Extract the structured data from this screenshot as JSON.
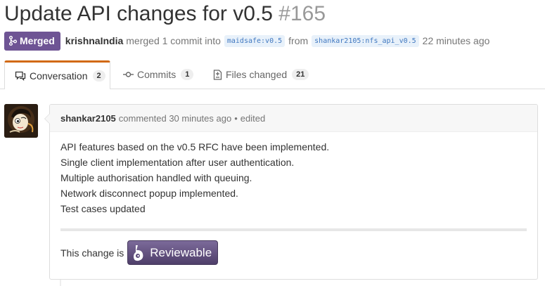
{
  "pr": {
    "title": "Update API changes for v0.5",
    "number": "#165"
  },
  "meta": {
    "state_label": "Merged",
    "author": "krishnaIndia",
    "merged_text": "merged 1 commit into",
    "base_branch": "maidsafe:v0.5",
    "from_text": "from",
    "head_branch": "shankar2105:nfs_api_v0.5",
    "time_ago": "22 minutes ago"
  },
  "tabs": [
    {
      "label": "Conversation",
      "count": "2",
      "icon": "comment-icon",
      "selected": true
    },
    {
      "label": "Commits",
      "count": "1",
      "icon": "commit-icon",
      "selected": false
    },
    {
      "label": "Files changed",
      "count": "21",
      "icon": "diff-icon",
      "selected": false
    }
  ],
  "comment": {
    "author": "shankar2105",
    "action": "commented 30 minutes ago",
    "separator": "•",
    "edited": "edited",
    "lines": [
      "API features based on the v0.5 RFC have been implemented.",
      "Single client implementation after user authentication.",
      "Multiple authorisation handled with queuing.",
      "Network disconnect popup implemented.",
      "Test cases updated"
    ],
    "reviewable_prefix": "This change is",
    "reviewable_label": "Reviewable"
  },
  "colors": {
    "merged_badge": "#6e5494",
    "selected_tab_top": "#d26911",
    "branch_bg": "#e8f1fa",
    "branch_text": "#4078c0"
  }
}
